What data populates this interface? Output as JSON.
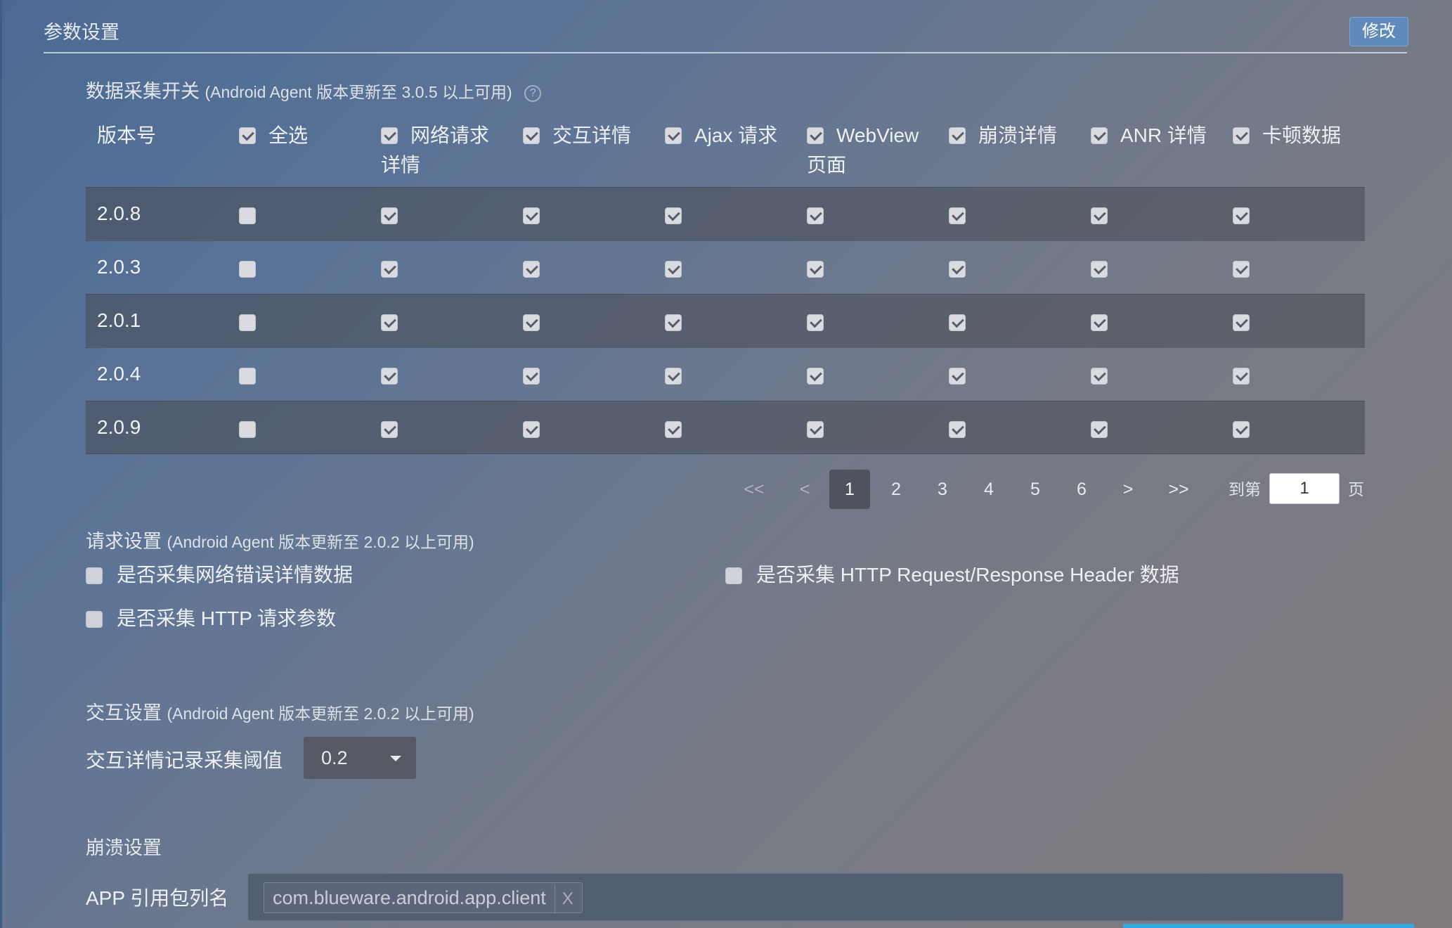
{
  "header": {
    "title": "参数设置",
    "edit_label": "修改"
  },
  "data_collection": {
    "title": "数据采集开关",
    "note": "(Android Agent 版本更新至 3.0.5 以上可用)",
    "help_icon": "?",
    "columns": [
      {
        "line1": "版本号",
        "line2": ""
      },
      {
        "line1": "全选",
        "line2": ""
      },
      {
        "line1": "网络请求",
        "line2": "详情"
      },
      {
        "line1": "交互详情",
        "line2": ""
      },
      {
        "line1": "Ajax 请求",
        "line2": ""
      },
      {
        "line1": "WebView",
        "line2": "页面"
      },
      {
        "line1": "崩溃详情",
        "line2": ""
      },
      {
        "line1": "ANR 详情",
        "line2": ""
      },
      {
        "line1": "卡顿数据",
        "line2": ""
      }
    ],
    "rows": [
      {
        "version": "2.0.8",
        "checks": [
          false,
          true,
          true,
          true,
          true,
          true,
          true,
          true
        ]
      },
      {
        "version": "2.0.3",
        "checks": [
          false,
          true,
          true,
          true,
          true,
          true,
          true,
          true
        ]
      },
      {
        "version": "2.0.1",
        "checks": [
          false,
          true,
          true,
          true,
          true,
          true,
          true,
          true
        ]
      },
      {
        "version": "2.0.4",
        "checks": [
          false,
          true,
          true,
          true,
          true,
          true,
          true,
          true
        ]
      },
      {
        "version": "2.0.9",
        "checks": [
          false,
          true,
          true,
          true,
          true,
          true,
          true,
          true
        ]
      }
    ]
  },
  "pagination": {
    "first": "<<",
    "prev": "<",
    "pages": [
      "1",
      "2",
      "3",
      "4",
      "5",
      "6"
    ],
    "next": ">",
    "last": ">>",
    "current": "1",
    "goto_prefix": "到第",
    "goto_value": "1",
    "goto_suffix": "页"
  },
  "request_settings": {
    "title": "请求设置",
    "note": "(Android Agent 版本更新至 2.0.2 以上可用)",
    "options": [
      {
        "label": "是否采集网络错误详情数据",
        "checked": false
      },
      {
        "label": "是否采集 HTTP Request/Response Header 数据",
        "checked": false
      },
      {
        "label": "是否采集 HTTP 请求参数",
        "checked": false
      }
    ]
  },
  "interaction_settings": {
    "title": "交互设置",
    "note": "(Android Agent 版本更新至 2.0.2 以上可用)",
    "threshold_label": "交互详情记录采集阈值",
    "threshold_value": "0.2"
  },
  "crash_settings": {
    "title": "崩溃设置",
    "package_label": "APP 引用包列名",
    "packages": [
      "com.blueware.android.app.client"
    ],
    "remove_label": "X"
  }
}
